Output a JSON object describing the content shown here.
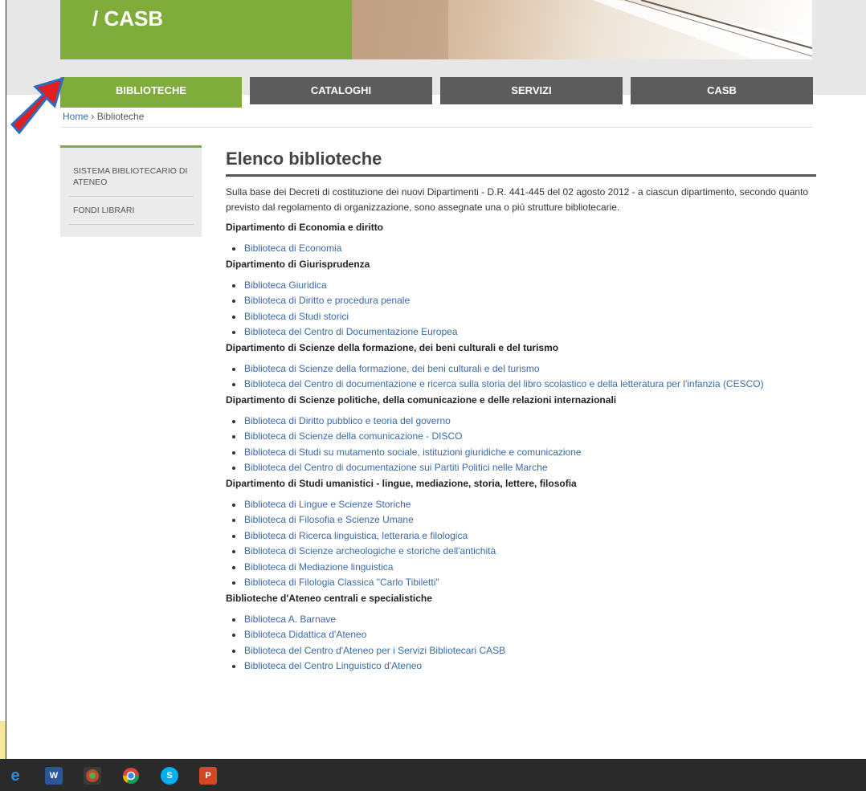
{
  "header": {
    "brand": "/ CASB"
  },
  "nav": {
    "tabs": [
      {
        "label": "BIBLIOTECHE",
        "active": true
      },
      {
        "label": "CATALOGHI",
        "active": false
      },
      {
        "label": "SERVIZI",
        "active": false
      },
      {
        "label": "CASB",
        "active": false
      }
    ]
  },
  "breadcrumb": {
    "home": "Home",
    "separator": "›",
    "current": "Biblioteche"
  },
  "sidebar": {
    "items": [
      {
        "label": "SISTEMA BIBLIOTECARIO DI ATENEO"
      },
      {
        "label": "FONDI LIBRARI"
      }
    ]
  },
  "main": {
    "title": "Elenco biblioteche",
    "intro": "Sulla base dei Decreti di costituzione dei nuovi Dipartimenti - D.R. 441-445 del 02 agosto 2012 - a ciascun dipartimento, secondo quanto previsto dal regolamento di organizzazione, sono assegnate una o più strutture bibliotecarie.",
    "sections": [
      {
        "heading": "Dipartimento di Economia e diritto",
        "items": [
          "Biblioteca di Economia"
        ]
      },
      {
        "heading": "Dipartimento di Giurisprudenza",
        "items": [
          "Biblioteca Giuridica",
          "Biblioteca di Diritto e procedura penale",
          "Biblioteca di Studi storici",
          "Biblioteca del Centro di Documentazione Europea"
        ]
      },
      {
        "heading": "Dipartimento di Scienze della formazione, dei beni culturali e del turismo",
        "items": [
          "Biblioteca di Scienze della formazione, dei beni culturali e del turismo",
          "Biblioteca del Centro di documentazione e ricerca sulla storia del libro scolastico e della letteratura per l'infanzia (CESCO)"
        ]
      },
      {
        "heading": "Dipartimento di Scienze politiche, della comunicazione e delle relazioni internazionali",
        "items": [
          "Biblioteca di Diritto pubblico e teoria del governo",
          "Biblioteca di Scienze della comunicazione - DISCO",
          "Biblioteca di Studi su mutamento sociale, istituzioni giuridiche e comunicazione",
          "Biblioteca del Centro di documentazione sui Partiti Politici nelle Marche"
        ]
      },
      {
        "heading": "Dipartimento di Studi umanistici - lingue, mediazione, storia, lettere, filosofia",
        "items": [
          "Biblioteca di Lingue e Scienze Storiche",
          "Biblioteca di Filosofia e Scienze Umane",
          "Biblioteca di Ricerca linguistica, letteraria e filologica",
          "Biblioteca di Scienze archeologiche e storiche dell'antichità",
          "Biblioteca di Mediazione linguistica",
          "Biblioteca di Filologia Classica \"Carlo Tibiletti\""
        ]
      },
      {
        "heading": "Biblioteche d'Ateneo centrali e specialistiche",
        "items": [
          "Biblioteca A. Barnave",
          "Biblioteca Didattica d'Ateneo",
          "Biblioteca del Centro d'Ateneo per i Servizi Bibliotecari CASB",
          "Biblioteca del Centro Linguistico d'Ateneo"
        ]
      }
    ]
  },
  "taskbar": {
    "icons": [
      {
        "name": "edge-icon",
        "glyph": "e",
        "color": "#2b8fd8"
      },
      {
        "name": "word-icon",
        "glyph": "W",
        "color": "#2b579a"
      },
      {
        "name": "app-icon",
        "glyph": "",
        "color": "#c04a2a"
      },
      {
        "name": "chrome-icon",
        "glyph": "",
        "color": "#f2b400"
      },
      {
        "name": "skype-icon",
        "glyph": "S",
        "color": "#00aff0"
      },
      {
        "name": "powerpoint-icon",
        "glyph": "P",
        "color": "#d24726"
      }
    ]
  },
  "colors": {
    "accent": "#7fac3b",
    "nav": "#5c5c5c",
    "link": "#3a6aa6",
    "arrow": "#e02020"
  }
}
